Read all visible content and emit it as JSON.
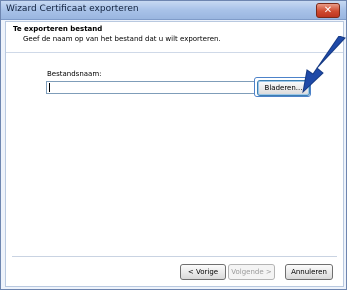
{
  "window": {
    "title": "Wizard Certificaat exporteren",
    "close_glyph": "✕"
  },
  "header": {
    "title": "Te exporteren bestand",
    "subtitle": "Geef de naam op van het bestand dat u wilt exporteren."
  },
  "form": {
    "filename_label": "Bestandsnaam:",
    "filename_value": "",
    "browse_label": "Bladeren..."
  },
  "footer": {
    "back_label": "< Vorige",
    "next_label": "Volgende >",
    "cancel_label": "Annuleren"
  },
  "colors": {
    "arrow": "#1f4aa8",
    "title_bar": "#a8c2e8",
    "close_button": "#cf4b30"
  },
  "icons": {
    "annotation": "pointer-arrow-icon",
    "close": "close-icon"
  }
}
